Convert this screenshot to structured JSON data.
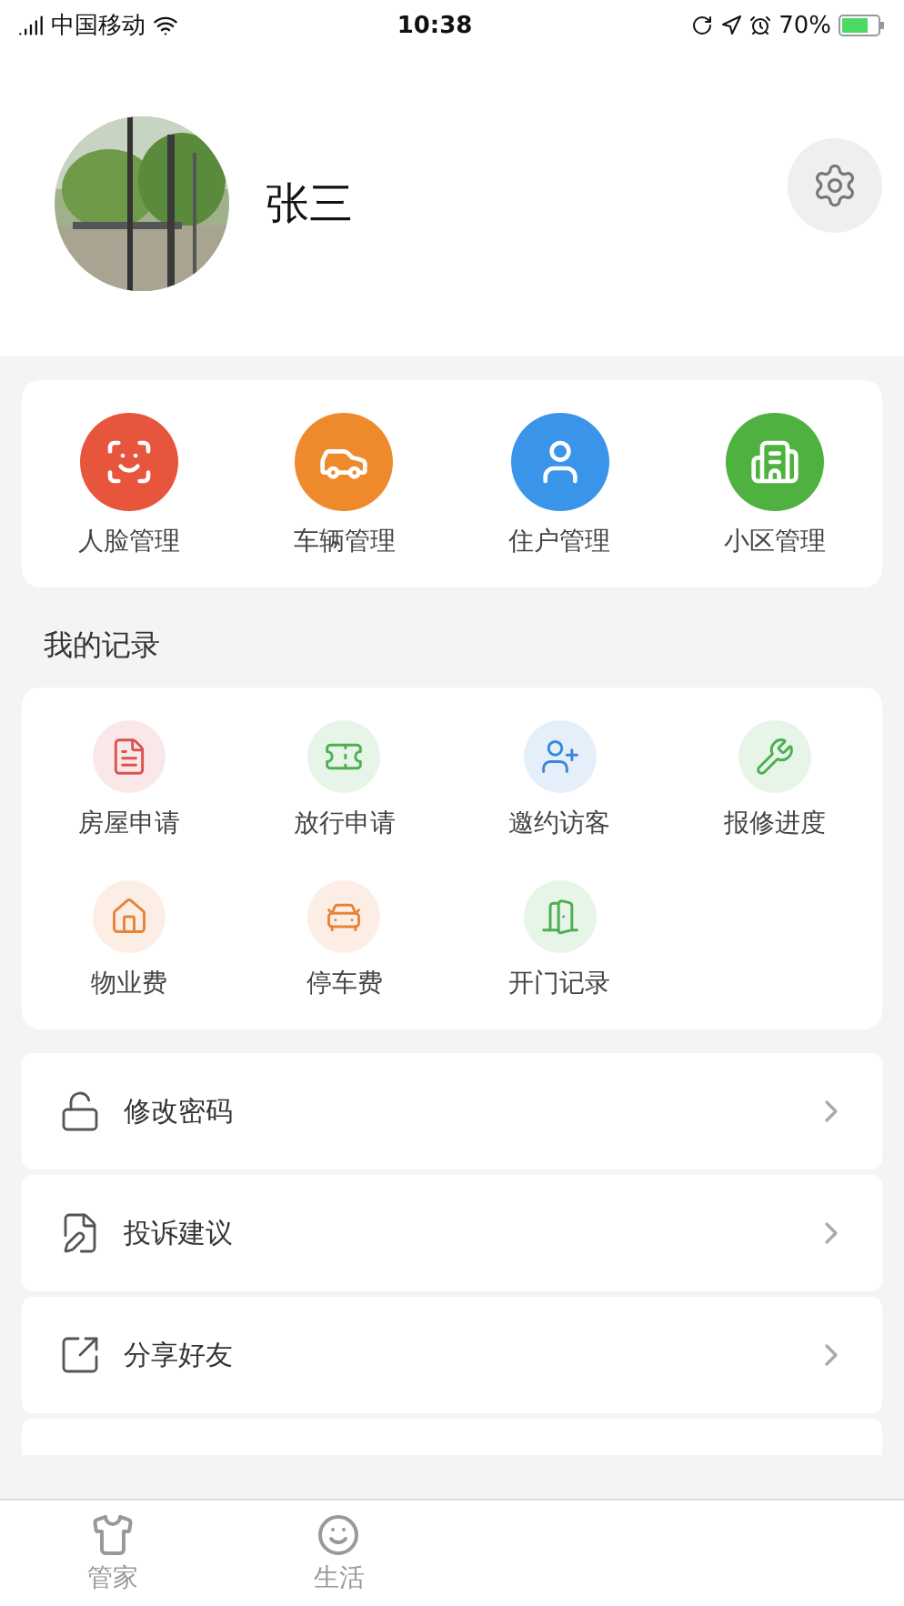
{
  "status_bar": {
    "carrier": "中国移动",
    "time": "10:38",
    "battery": "70%"
  },
  "profile": {
    "name": "张三"
  },
  "quick_actions": [
    {
      "label": "人脸管理",
      "color": "#e8553d"
    },
    {
      "label": "车辆管理",
      "color": "#ef8a2c"
    },
    {
      "label": "住户管理",
      "color": "#3a94ea"
    },
    {
      "label": "小区管理",
      "color": "#4fb13f"
    }
  ],
  "records": {
    "title": "我的记录",
    "items": [
      {
        "label": "房屋申请",
        "color": "#d9534f"
      },
      {
        "label": "放行申请",
        "color": "#4caf50"
      },
      {
        "label": "邀约访客",
        "color": "#3a87d9"
      },
      {
        "label": "报修进度",
        "color": "#4caf50"
      },
      {
        "label": "物业费",
        "color": "#e8833a"
      },
      {
        "label": "停车费",
        "color": "#e8833a"
      },
      {
        "label": "开门记录",
        "color": "#4caf50"
      }
    ]
  },
  "menu": [
    {
      "label": "修改密码"
    },
    {
      "label": "投诉建议"
    },
    {
      "label": "分享好友"
    }
  ],
  "tab_bar": [
    {
      "label": "管家",
      "selected": false
    },
    {
      "label": "生活",
      "selected": false
    }
  ]
}
